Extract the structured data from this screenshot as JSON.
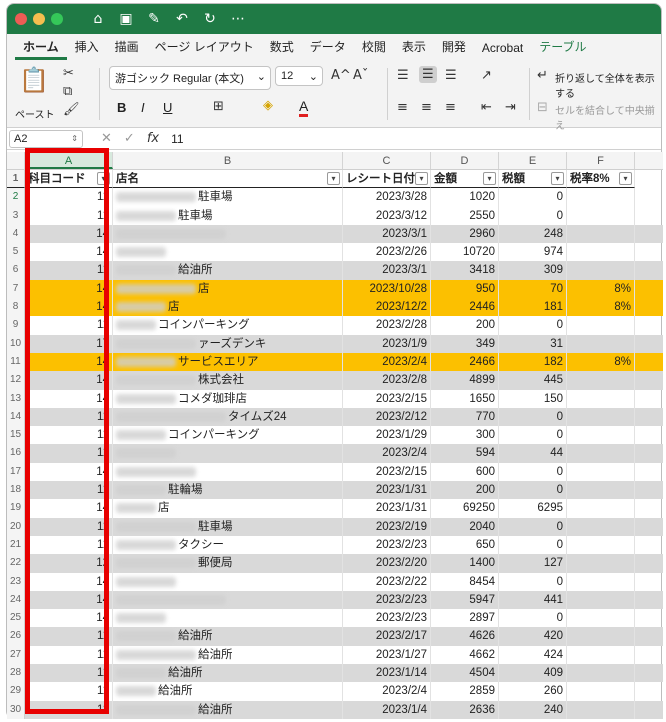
{
  "titlebar": {
    "colors": {
      "close": "#ee5c55",
      "minimize": "#f6be4f",
      "maximize": "#35c759",
      "bar": "#1f7a45"
    },
    "icons": [
      "home-icon",
      "save-icon",
      "edit-save-icon",
      "undo-icon",
      "redo-icon",
      "more-icon"
    ]
  },
  "tabs": [
    "ホーム",
    "挿入",
    "描画",
    "ページ レイアウト",
    "数式",
    "データ",
    "校閲",
    "表示",
    "開発",
    "Acrobat",
    "テーブル"
  ],
  "ribbon": {
    "paste_label": "ペースト",
    "font_name": "游ゴシック Regular (本文)",
    "font_size": "12",
    "bold": "B",
    "italic": "I",
    "underline": "U",
    "wrap_text": "折り返して全体を表示する",
    "merge_center": "セルを結合して中央揃え"
  },
  "formula_bar": {
    "name_box": "A2",
    "fx": "fx",
    "value": "11"
  },
  "columns": [
    "A",
    "B",
    "C",
    "D",
    "E",
    "F"
  ],
  "headers": [
    "科目コード",
    "店名",
    "レシート日付",
    "金額",
    "税額",
    "税率8%"
  ],
  "rows": [
    {
      "n": "2",
      "a": "11",
      "b": "駐車場",
      "c": "2023/3/28",
      "d": "1020",
      "e": "0",
      "f": "",
      "style": ""
    },
    {
      "n": "3",
      "a": "11",
      "b": "駐車場",
      "c": "2023/3/12",
      "d": "2550",
      "e": "0",
      "f": "",
      "style": ""
    },
    {
      "n": "4",
      "a": "14",
      "b": "",
      "c": "2023/3/1",
      "d": "2960",
      "e": "248",
      "f": "",
      "style": "stripe"
    },
    {
      "n": "5",
      "a": "14",
      "b": "",
      "c": "2023/2/26",
      "d": "10720",
      "e": "974",
      "f": "",
      "style": ""
    },
    {
      "n": "6",
      "a": "11",
      "b": "給油所",
      "c": "2023/3/1",
      "d": "3418",
      "e": "309",
      "f": "",
      "style": "stripe"
    },
    {
      "n": "7",
      "a": "14",
      "b": "店",
      "c": "2023/10/28",
      "d": "950",
      "e": "70",
      "f": "8%",
      "style": "orange"
    },
    {
      "n": "8",
      "a": "14",
      "b": "店",
      "c": "2023/12/2",
      "d": "2446",
      "e": "181",
      "f": "8%",
      "style": "orange"
    },
    {
      "n": "9",
      "a": "11",
      "b": "コインパーキング",
      "c": "2023/2/28",
      "d": "200",
      "e": "0",
      "f": "",
      "style": ""
    },
    {
      "n": "10",
      "a": "17",
      "b": "ァーズデンキ",
      "c": "2023/1/9",
      "d": "349",
      "e": "31",
      "f": "",
      "style": "stripe"
    },
    {
      "n": "11",
      "a": "14",
      "b": "サービスエリア",
      "c": "2023/2/4",
      "d": "2466",
      "e": "182",
      "f": "8%",
      "style": "orange"
    },
    {
      "n": "12",
      "a": "14",
      "b": "株式会社",
      "c": "2023/2/8",
      "d": "4899",
      "e": "445",
      "f": "",
      "style": "stripe"
    },
    {
      "n": "13",
      "a": "14",
      "b": "コメダ珈琲店",
      "c": "2023/2/15",
      "d": "1650",
      "e": "150",
      "f": "",
      "style": ""
    },
    {
      "n": "14",
      "a": "11",
      "b": "タイムズ24",
      "c": "2023/2/12",
      "d": "770",
      "e": "0",
      "f": "",
      "style": "stripe"
    },
    {
      "n": "15",
      "a": "11",
      "b": "コインパーキング",
      "c": "2023/1/29",
      "d": "300",
      "e": "0",
      "f": "",
      "style": ""
    },
    {
      "n": "16",
      "a": "11",
      "b": "",
      "c": "2023/2/4",
      "d": "594",
      "e": "44",
      "f": "",
      "style": "stripe"
    },
    {
      "n": "17",
      "a": "14",
      "b": "",
      "c": "2023/2/15",
      "d": "600",
      "e": "0",
      "f": "",
      "style": ""
    },
    {
      "n": "18",
      "a": "11",
      "b": "駐輪場",
      "c": "2023/1/31",
      "d": "200",
      "e": "0",
      "f": "",
      "style": "stripe"
    },
    {
      "n": "19",
      "a": "14",
      "b": "店",
      "c": "2023/1/31",
      "d": "69250",
      "e": "6295",
      "f": "",
      "style": ""
    },
    {
      "n": "20",
      "a": "11",
      "b": "駐車場",
      "c": "2023/2/19",
      "d": "2040",
      "e": "0",
      "f": "",
      "style": "stripe"
    },
    {
      "n": "21",
      "a": "11",
      "b": "タクシー",
      "c": "2023/2/23",
      "d": "650",
      "e": "0",
      "f": "",
      "style": ""
    },
    {
      "n": "22",
      "a": "12",
      "b": "郵便局",
      "c": "2023/2/20",
      "d": "1400",
      "e": "127",
      "f": "",
      "style": "stripe"
    },
    {
      "n": "23",
      "a": "14",
      "b": "",
      "c": "2023/2/22",
      "d": "8454",
      "e": "0",
      "f": "",
      "style": ""
    },
    {
      "n": "24",
      "a": "14",
      "b": "",
      "c": "2023/2/23",
      "d": "5947",
      "e": "441",
      "f": "",
      "style": "stripe"
    },
    {
      "n": "25",
      "a": "14",
      "b": "",
      "c": "2023/2/23",
      "d": "2897",
      "e": "0",
      "f": "",
      "style": ""
    },
    {
      "n": "26",
      "a": "11",
      "b": "給油所",
      "c": "2023/2/17",
      "d": "4626",
      "e": "420",
      "f": "",
      "style": "stripe"
    },
    {
      "n": "27",
      "a": "11",
      "b": "給油所",
      "c": "2023/1/27",
      "d": "4662",
      "e": "424",
      "f": "",
      "style": ""
    },
    {
      "n": "28",
      "a": "11",
      "b": "給油所",
      "c": "2023/1/14",
      "d": "4504",
      "e": "409",
      "f": "",
      "style": "stripe"
    },
    {
      "n": "29",
      "a": "11",
      "b": "給油所",
      "c": "2023/2/4",
      "d": "2859",
      "e": "260",
      "f": "",
      "style": ""
    },
    {
      "n": "30",
      "a": "11",
      "b": "給油所",
      "c": "2023/1/4",
      "d": "2636",
      "e": "240",
      "f": "",
      "style": "stripe"
    }
  ],
  "colors": {
    "stripe": "#d9d9d9",
    "orange": "#fcc000",
    "highlight": "#e80000",
    "accent": "#1f7a45"
  }
}
